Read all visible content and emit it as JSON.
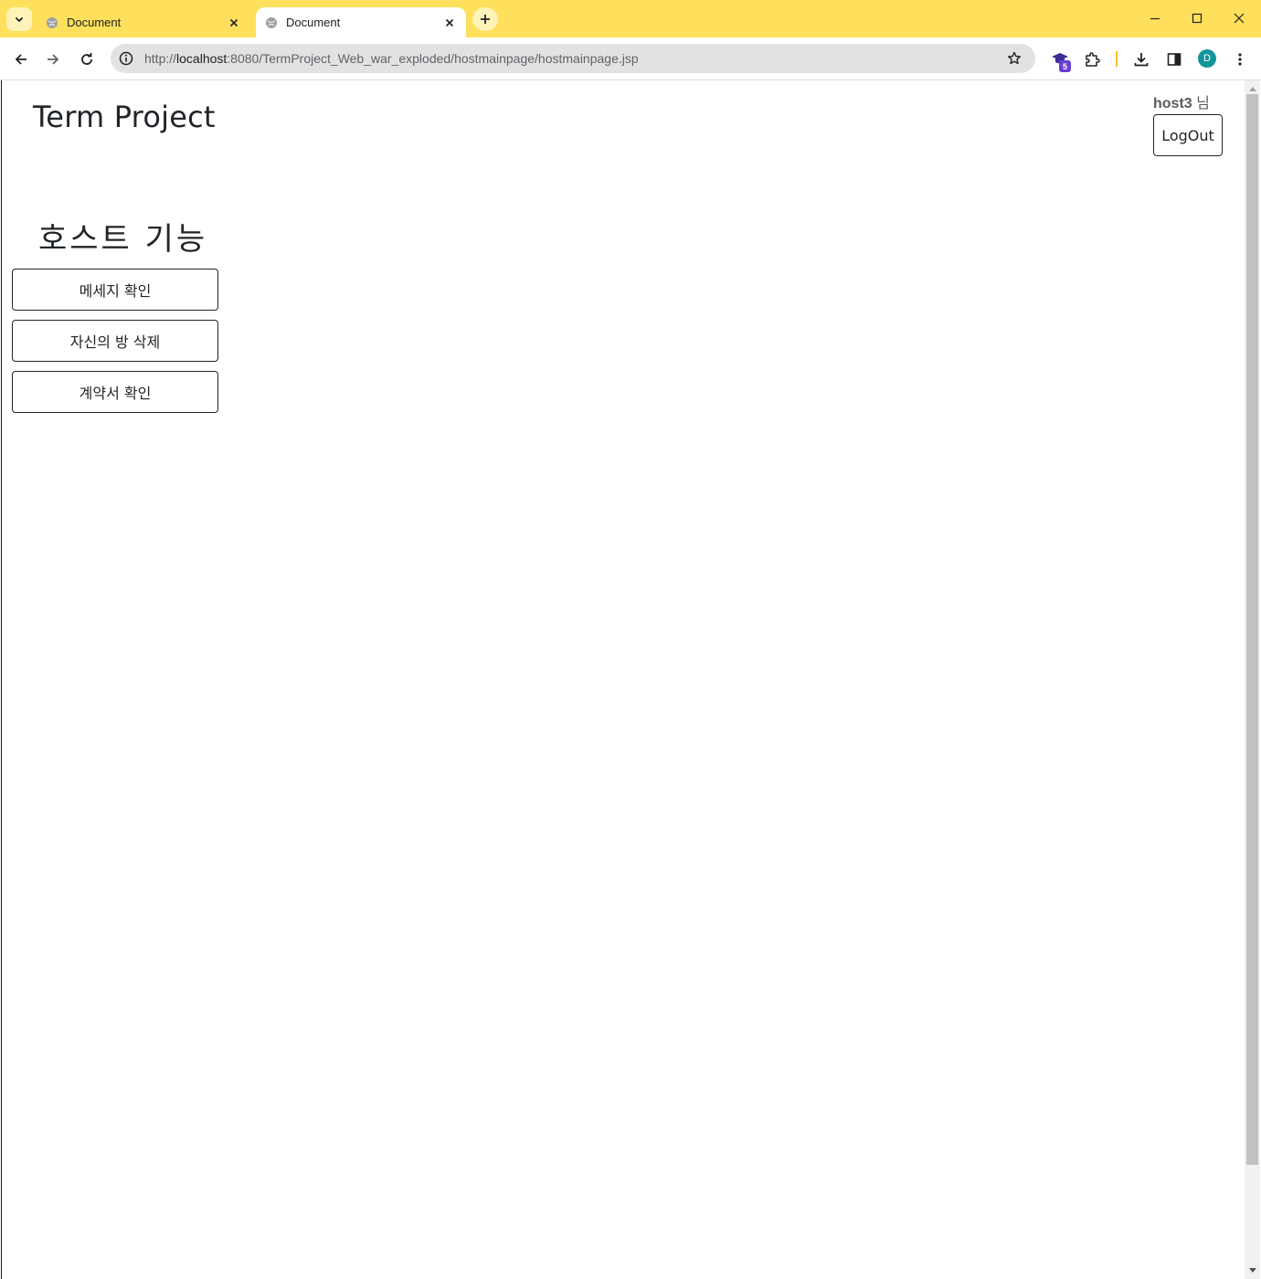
{
  "browser": {
    "tabs": [
      {
        "title": "Document",
        "active": false
      },
      {
        "title": "Document",
        "active": true
      }
    ],
    "url": {
      "scheme": "http://",
      "host": "localhost",
      "rest": ":8080/TermProject_Web_war_exploded/hostmainpage/hostmainpage.jsp"
    },
    "extension_badge": "5",
    "profile_initial": "D",
    "theme_color": "#ffe05c"
  },
  "page": {
    "brand": "Term Project",
    "user": {
      "name": "host3",
      "suffix": "님"
    },
    "logout_label": "LogOut",
    "section_title": "호스트 기능",
    "actions": [
      {
        "label": "메세지 확인"
      },
      {
        "label": "자신의 방 삭제"
      },
      {
        "label": "계약서 확인"
      }
    ]
  }
}
